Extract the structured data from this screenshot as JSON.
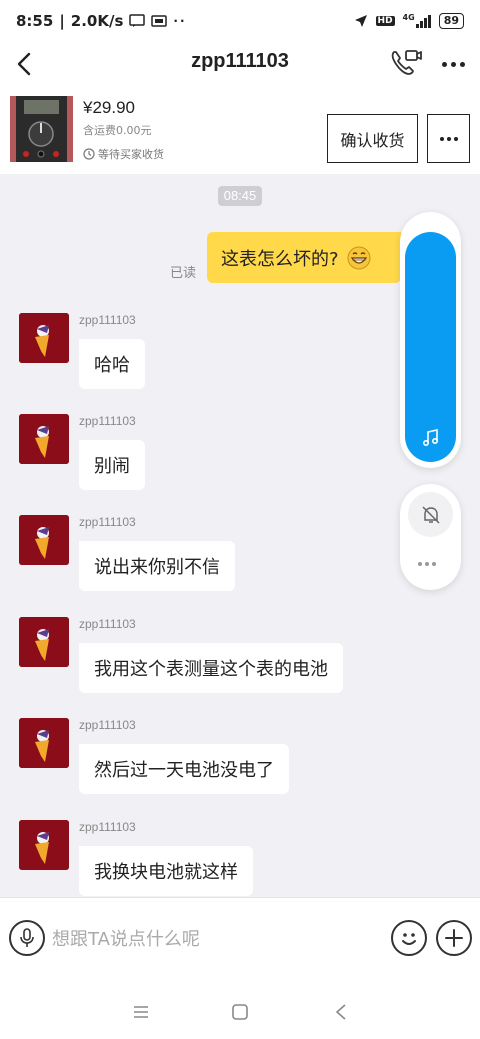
{
  "status_bar": {
    "time": "8:55",
    "speed": "2.0K/s",
    "network": "4G",
    "battery": "89",
    "hd": "HD"
  },
  "header": {
    "title": "zpp111103"
  },
  "product": {
    "price": "¥29.90",
    "shipping": "含运费0.00元",
    "status": "等待买家收货",
    "confirm_label": "确认收货"
  },
  "chat": {
    "time_divider": "08:45",
    "outgoing": {
      "text": "这表怎么坏的?",
      "read_receipt": "已读"
    },
    "incoming": [
      {
        "sender": "zpp111103",
        "text": "哈哈"
      },
      {
        "sender": "zpp111103",
        "text": "别闹"
      },
      {
        "sender": "zpp111103",
        "text": "说出来你别不信"
      },
      {
        "sender": "zpp111103",
        "text": "我用这个表测量这个表的电池"
      },
      {
        "sender": "zpp111103",
        "text": "然后过一天电池没电了"
      },
      {
        "sender": "zpp111103",
        "text": "我换块电池就这样"
      }
    ]
  },
  "input_bar": {
    "placeholder": "想跟TA说点什么呢"
  },
  "colors": {
    "accent_yellow": "#ffd94a",
    "player_blue": "#0a9cf3",
    "avatar_red": "#8b0d1a"
  },
  "icons": {
    "back": "chevron-left-icon",
    "call": "phone-video-icon",
    "more": "more-dots-icon",
    "clock": "clock-icon",
    "emoji": "grin-emoji-icon",
    "music": "music-note-icon",
    "bell": "bell-off-icon",
    "voice": "microphone-icon",
    "smile": "smile-icon",
    "plus": "plus-icon",
    "nav_menu": "menu-icon",
    "nav_home": "square-home-icon",
    "nav_back": "triangle-back-icon"
  }
}
